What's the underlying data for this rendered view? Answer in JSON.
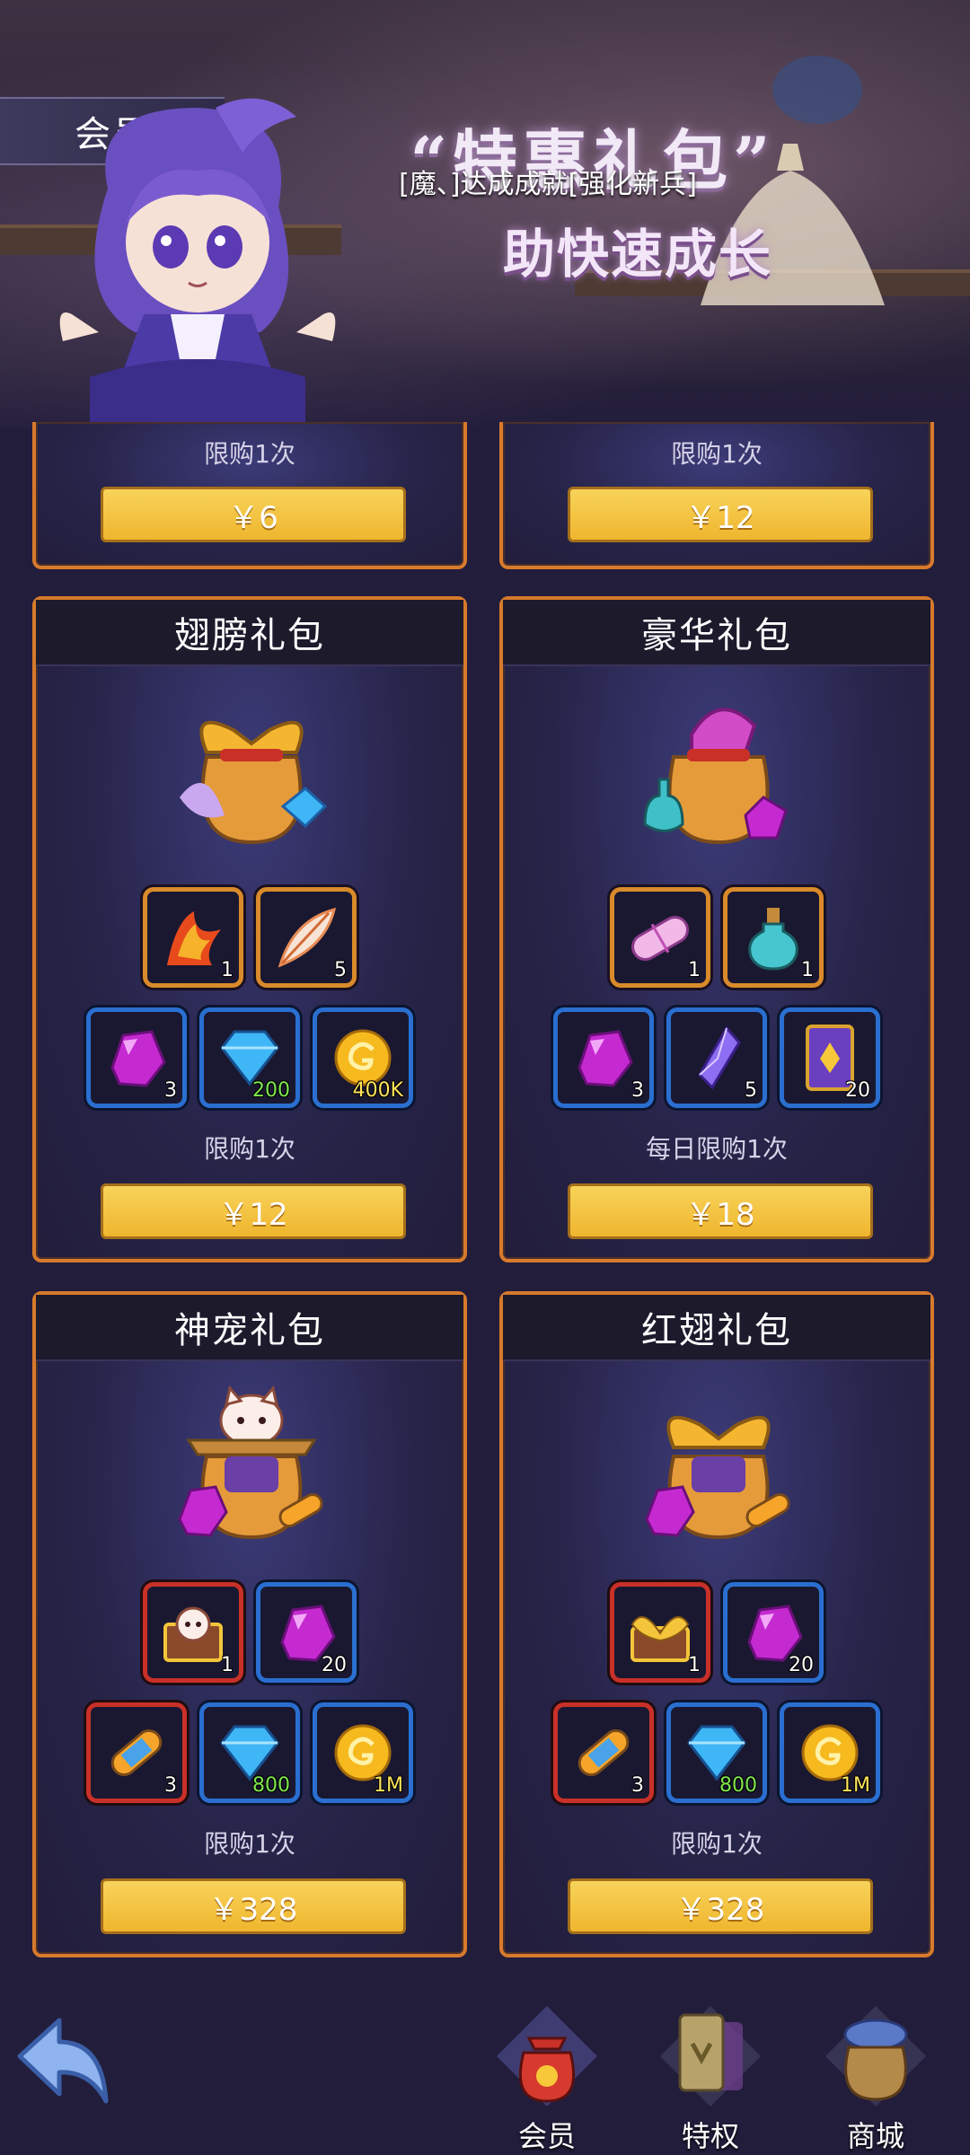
{
  "banner": {
    "tag": "会员",
    "title": "“特惠礼包”",
    "subtitle": "[魔、]达成成就[强化新兵]",
    "slogan": "助快速成长"
  },
  "colors": {
    "accent": "#d77a2c",
    "button": "#efb62e",
    "background": "#221d3b"
  },
  "packs": [
    {
      "name": "",
      "limit": "限购1次",
      "price": "￥6"
    },
    {
      "name": "",
      "limit": "限购1次",
      "price": "￥12"
    },
    {
      "name": "翅膀礼包",
      "icon": "wing-bag-icon",
      "items_row1": [
        {
          "icon": "phoenix-wing-icon",
          "qty": "1"
        },
        {
          "icon": "feather-icon",
          "qty": "5"
        }
      ],
      "items_row2": [
        {
          "icon": "purple-gem-icon",
          "qty": "3"
        },
        {
          "icon": "diamond-icon",
          "qty": "200"
        },
        {
          "icon": "gold-coin-icon",
          "qty": "400K"
        }
      ],
      "limit": "限购1次",
      "price": "￥12"
    },
    {
      "name": "豪华礼包",
      "icon": "luxury-bag-icon",
      "items_row1": [
        {
          "icon": "pill-capsule-icon",
          "qty": "1"
        },
        {
          "icon": "potion-icon",
          "qty": "1"
        }
      ],
      "items_row2": [
        {
          "icon": "purple-gem-icon",
          "qty": "3"
        },
        {
          "icon": "crystal-shard-icon",
          "qty": "5"
        },
        {
          "icon": "card-icon",
          "qty": "20"
        }
      ],
      "limit": "每日限购1次",
      "price": "￥18"
    },
    {
      "name": "神宠礼包",
      "icon": "pet-bag-icon",
      "items_row1": [
        {
          "icon": "pet-chest-icon",
          "qty": "1"
        },
        {
          "icon": "purple-gem-icon",
          "qty": "20"
        }
      ],
      "items_row2": [
        {
          "icon": "scroll-icon",
          "qty": "3"
        },
        {
          "icon": "diamond-icon",
          "qty": "800"
        },
        {
          "icon": "gold-coin-icon",
          "qty": "1M"
        }
      ],
      "limit": "限购1次",
      "price": "￥328"
    },
    {
      "name": "红翅礼包",
      "icon": "red-wing-bag-icon",
      "items_row1": [
        {
          "icon": "wing-chest-icon",
          "qty": "1"
        },
        {
          "icon": "purple-gem-icon",
          "qty": "20"
        }
      ],
      "items_row2": [
        {
          "icon": "scroll-icon",
          "qty": "3"
        },
        {
          "icon": "diamond-icon",
          "qty": "800"
        },
        {
          "icon": "gold-coin-icon",
          "qty": "1M"
        }
      ],
      "limit": "限购1次",
      "price": "￥328"
    }
  ],
  "nav": {
    "back_icon": "back-arrow-icon",
    "items": [
      {
        "label": "会员",
        "icon": "red-bag-icon"
      },
      {
        "label": "特权",
        "icon": "privilege-card-icon"
      },
      {
        "label": "商城",
        "icon": "shop-bag-icon"
      }
    ]
  }
}
